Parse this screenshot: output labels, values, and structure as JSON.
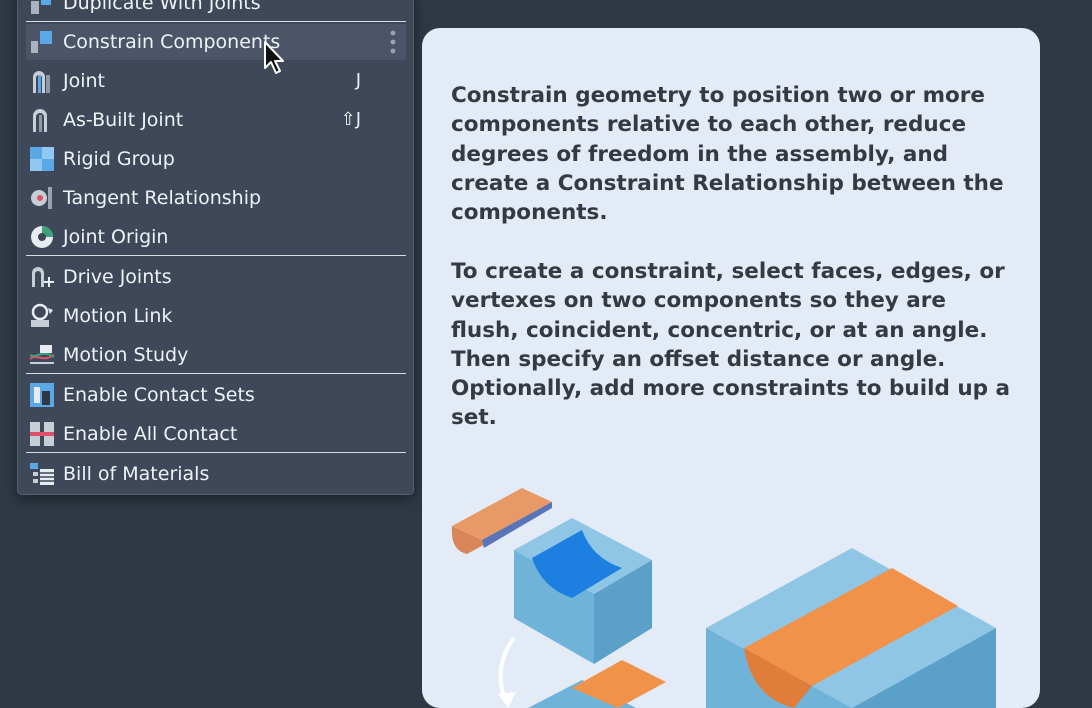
{
  "menu": {
    "items": [
      {
        "label": "Duplicate With Joints",
        "shortcut": "",
        "icon": "duplicate-with-joints-icon"
      },
      {
        "label": "Constrain Components",
        "shortcut": "",
        "icon": "constrain-components-icon",
        "highlighted": true
      },
      {
        "label": "Joint",
        "shortcut": "J",
        "icon": "joint-icon"
      },
      {
        "label": "As-Built Joint",
        "shortcut": "⇧J",
        "icon": "as-built-joint-icon"
      },
      {
        "label": "Rigid Group",
        "shortcut": "",
        "icon": "rigid-group-icon"
      },
      {
        "label": "Tangent Relationship",
        "shortcut": "",
        "icon": "tangent-relationship-icon"
      },
      {
        "label": "Joint Origin",
        "shortcut": "",
        "icon": "joint-origin-icon"
      },
      {
        "label": "Drive Joints",
        "shortcut": "",
        "icon": "drive-joints-icon"
      },
      {
        "label": "Motion Link",
        "shortcut": "",
        "icon": "motion-link-icon"
      },
      {
        "label": "Motion Study",
        "shortcut": "",
        "icon": "motion-study-icon"
      },
      {
        "label": "Enable Contact Sets",
        "shortcut": "",
        "icon": "enable-contact-sets-icon"
      },
      {
        "label": "Enable All Contact",
        "shortcut": "",
        "icon": "enable-all-contact-icon"
      },
      {
        "label": "Bill of Materials",
        "shortcut": "",
        "icon": "bill-of-materials-icon"
      }
    ]
  },
  "tooltip": {
    "paragraph1": "Constrain geometry to position two or more components relative to each other, reduce degrees of freedom in the assembly, and create a Constraint Relationship between the components.",
    "paragraph2": "To create a constraint, select faces, edges, or vertexes on two components so they are flush, coincident, concentric, or at an angle. Then specify an offset distance or angle. Optionally, add more constraints to build up a set."
  },
  "colors": {
    "menu_bg": "#3e4858",
    "menu_highlight": "#4b5567",
    "tooltip_bg": "#e3ebf6",
    "icon_blue": "#5aa9e6",
    "part_blue": "#6fb3d9",
    "face_orange": "#f19a52"
  }
}
